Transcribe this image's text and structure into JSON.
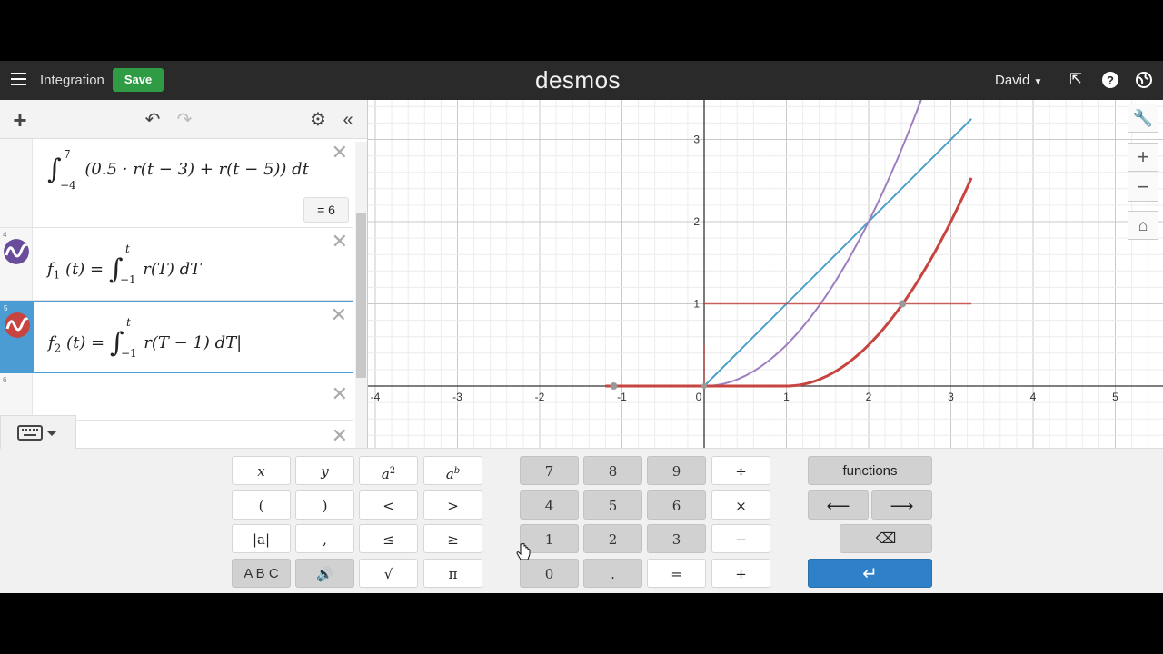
{
  "header": {
    "graph_title": "Integration",
    "save_label": "Save",
    "brand": "desmos",
    "user": "David"
  },
  "expressions": [
    {
      "id": "3",
      "integral_upper": "7",
      "integral_lower": "−4",
      "body": "(0.5 · r(t − 3) + r(t − 5)) dt",
      "result": "= 6"
    },
    {
      "id": "4",
      "lhs": "f",
      "lhs_sub": "1",
      "lhs_arg": "(t) =",
      "integral_upper": "t",
      "integral_lower": "−1",
      "body": "r(T) dT",
      "color": "#6a4c9c"
    },
    {
      "id": "5",
      "lhs": "f",
      "lhs_sub": "2",
      "lhs_arg": "(t) =",
      "integral_upper": "t",
      "integral_lower": "−1",
      "body": "r(T − 1) dT",
      "color": "#c74440"
    },
    {
      "id": "6"
    }
  ],
  "graph": {
    "x_ticks": [
      "-4",
      "-3",
      "-2",
      "-1",
      "0",
      "1",
      "2",
      "3",
      "4",
      "5"
    ],
    "y_ticks": [
      "1",
      "2",
      "3"
    ]
  },
  "keypad": {
    "left": [
      [
        "x",
        "y",
        "a2",
        "ab"
      ],
      [
        "(",
        ")",
        "<",
        ">"
      ],
      [
        "|a|",
        ",",
        "≤",
        "≥"
      ],
      [
        "A B C",
        "speaker",
        "√",
        "π"
      ]
    ],
    "numbers": [
      [
        "7",
        "8",
        "9",
        "÷"
      ],
      [
        "4",
        "5",
        "6",
        "×"
      ],
      [
        "1",
        "2",
        "3",
        "−"
      ],
      [
        "0",
        ".",
        "=",
        "+"
      ]
    ],
    "functions_label": "functions",
    "left_arrow": "⟵",
    "right_arrow": "⟶",
    "backspace": "⌫",
    "enter": "↵"
  },
  "colors": {
    "header_bg": "#2a2a2a",
    "save_green": "#2f9b45",
    "active_blue": "#4b9cd3",
    "red": "#c74440",
    "purple": "#9d7ec0",
    "blue": "#4c9fc8"
  }
}
